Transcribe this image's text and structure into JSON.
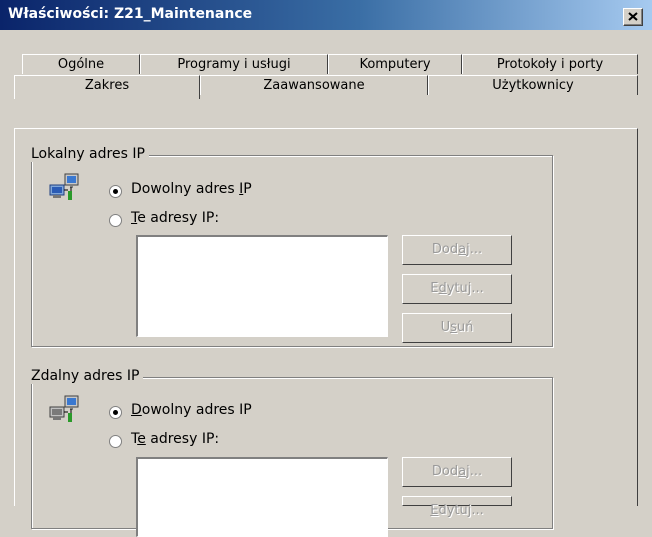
{
  "window": {
    "title": "Właściwości: Z21_Maintenance"
  },
  "tabs_row1": [
    "Ogólne",
    "Programy i usługi",
    "Komputery",
    "Protokoły i porty"
  ],
  "tabs_row2": [
    "Zakres",
    "Zaawansowane",
    "Użytkownicy"
  ],
  "active_tab": "Zakres",
  "local": {
    "legend": "Lokalny adres IP",
    "radio_any": {
      "pre": "Dowolny adres ",
      "key": "I",
      "post": "P",
      "selected": true
    },
    "radio_these": {
      "pre": "",
      "key": "T",
      "post": "e adresy IP:",
      "selected": false
    },
    "buttons": {
      "add": {
        "pre": "Dod",
        "key": "a",
        "post": "j..."
      },
      "edit": {
        "pre": "E",
        "key": "d",
        "post": "ytuj..."
      },
      "remove": {
        "pre": "U",
        "key": "s",
        "post": "uń"
      }
    }
  },
  "remote": {
    "legend": "Zdalny adres IP",
    "radio_any": {
      "pre": "",
      "key": "D",
      "post": "owolny adres IP",
      "selected": true
    },
    "radio_these": {
      "pre": "T",
      "key": "e",
      "post": " adresy IP:",
      "selected": false
    },
    "buttons": {
      "add": {
        "pre": "Dod",
        "key": "a",
        "post": "j..."
      },
      "edit": {
        "pre": "",
        "key": "E",
        "post": "dytuj..."
      }
    }
  }
}
